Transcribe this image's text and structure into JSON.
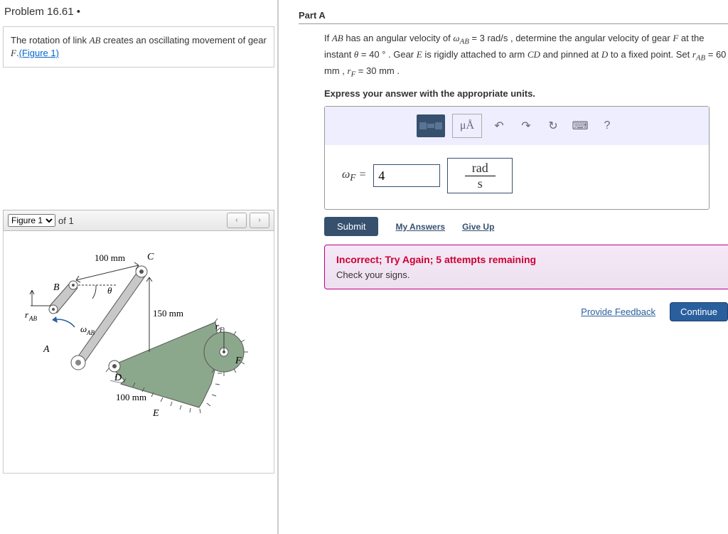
{
  "problem": {
    "title": "Problem 16.61 •"
  },
  "desc": {
    "pre": "The rotation of link ",
    "ab": "AB",
    "mid": " creates an oscillating movement of gear ",
    "f": "F",
    "post": ".",
    "figlink": "(Figure 1)"
  },
  "figbar": {
    "select": "Figure 1",
    "of": "of 1",
    "prev": "‹",
    "next": "›"
  },
  "figure": {
    "bc": "100 mm",
    "cd": "150 mm",
    "de": "100 mm",
    "rab": "r",
    "rabsub": "AB",
    "wab": "ω",
    "wabsub": "AB",
    "rf": "r",
    "rfsub": "F",
    "A": "A",
    "B": "B",
    "C": "C",
    "D": "D",
    "E": "E",
    "F": "F",
    "theta": "θ"
  },
  "partA": {
    "title": "Part A",
    "q1": "If ",
    "ab": "AB",
    "q2": " has an angular velocity of ",
    "wab": "ω",
    "wabsub": "AB",
    "q3": " = 3 rad/s , determine the angular velocity of gear ",
    "f": "F",
    "q4": " at the instant ",
    "th": "θ",
    "q5": " = 40 ° . Gear ",
    "e": "E",
    "q6": " is rigidly attached to arm ",
    "cd": "CD",
    "q7": " and pinned at ",
    "d": "D",
    "q8": " to a fixed point. Set ",
    "r1": "r",
    "r1s": "AB",
    "q9": " = 60 mm , ",
    "r2": "r",
    "r2s": "F",
    "q10": " = 30 mm .",
    "instr": "Express your answer with the appropriate units."
  },
  "toolbar": {
    "mu": "μÅ",
    "undo": "↶",
    "redo": "↷",
    "reset": "↻",
    "kbd": "⌨",
    "help": "?"
  },
  "answer": {
    "label": "ω",
    "labelsub": "F",
    "eq": " = ",
    "value": "4",
    "unit_num": "rad",
    "unit_den": "s"
  },
  "submit": {
    "btn": "Submit",
    "my": "My Answers",
    "give": "Give Up"
  },
  "feedback": {
    "title": "Incorrect; Try Again; 5 attempts remaining",
    "hint": "Check your signs."
  },
  "bottom": {
    "pf": "Provide Feedback",
    "cont": "Continue"
  }
}
